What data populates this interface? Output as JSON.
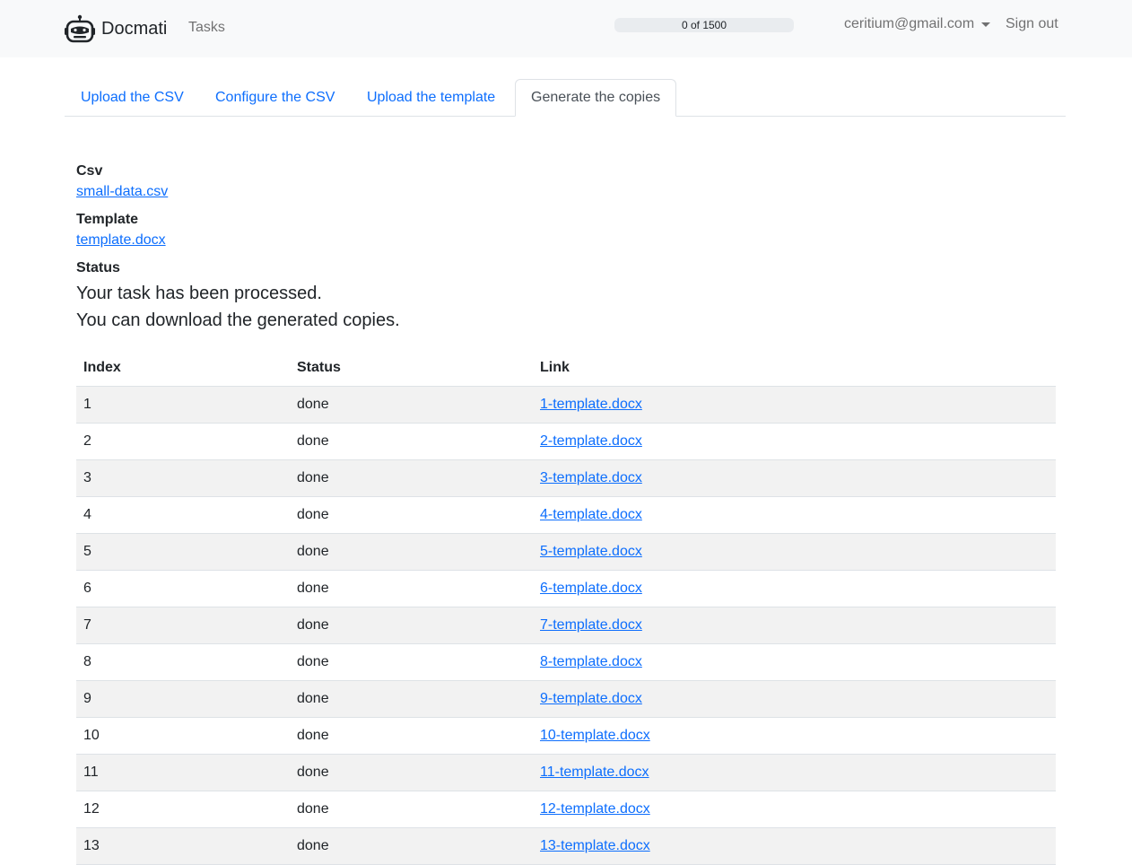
{
  "navbar": {
    "brand_icon": "robot-logo-icon",
    "brand_name": "Docmati",
    "tasks_link": "Tasks",
    "progress": {
      "label": "0 of 1500",
      "value": 0,
      "max": 1500,
      "color": "#0d6efd"
    },
    "user_email": "ceritium@gmail.com",
    "user_menu_icon": "chevron-down-icon",
    "sign_out": "Sign out"
  },
  "tabs": [
    {
      "label": "Upload the CSV",
      "active": false
    },
    {
      "label": "Configure the CSV",
      "active": false
    },
    {
      "label": "Upload the template",
      "active": false
    },
    {
      "label": "Generate the copies",
      "active": true
    }
  ],
  "details": {
    "csv_label": "Csv",
    "csv_file": "small-data.csv",
    "template_label": "Template",
    "template_file": "template.docx",
    "status_label": "Status",
    "status_line1": "Your task has been processed.",
    "status_line2": "You can download the generated copies."
  },
  "table": {
    "headers": {
      "index": "Index",
      "status": "Status",
      "link": "Link"
    },
    "rows": [
      {
        "index": "1",
        "status": "done",
        "link": "1-template.docx"
      },
      {
        "index": "2",
        "status": "done",
        "link": "2-template.docx"
      },
      {
        "index": "3",
        "status": "done",
        "link": "3-template.docx"
      },
      {
        "index": "4",
        "status": "done",
        "link": "4-template.docx"
      },
      {
        "index": "5",
        "status": "done",
        "link": "5-template.docx"
      },
      {
        "index": "6",
        "status": "done",
        "link": "6-template.docx"
      },
      {
        "index": "7",
        "status": "done",
        "link": "7-template.docx"
      },
      {
        "index": "8",
        "status": "done",
        "link": "8-template.docx"
      },
      {
        "index": "9",
        "status": "done",
        "link": "9-template.docx"
      },
      {
        "index": "10",
        "status": "done",
        "link": "10-template.docx"
      },
      {
        "index": "11",
        "status": "done",
        "link": "11-template.docx"
      },
      {
        "index": "12",
        "status": "done",
        "link": "12-template.docx"
      },
      {
        "index": "13",
        "status": "done",
        "link": "13-template.docx"
      }
    ]
  },
  "colors": {
    "link": "#0d6efd",
    "navbar_bg": "#f8f9fa",
    "stripe": "#f2f2f2"
  }
}
